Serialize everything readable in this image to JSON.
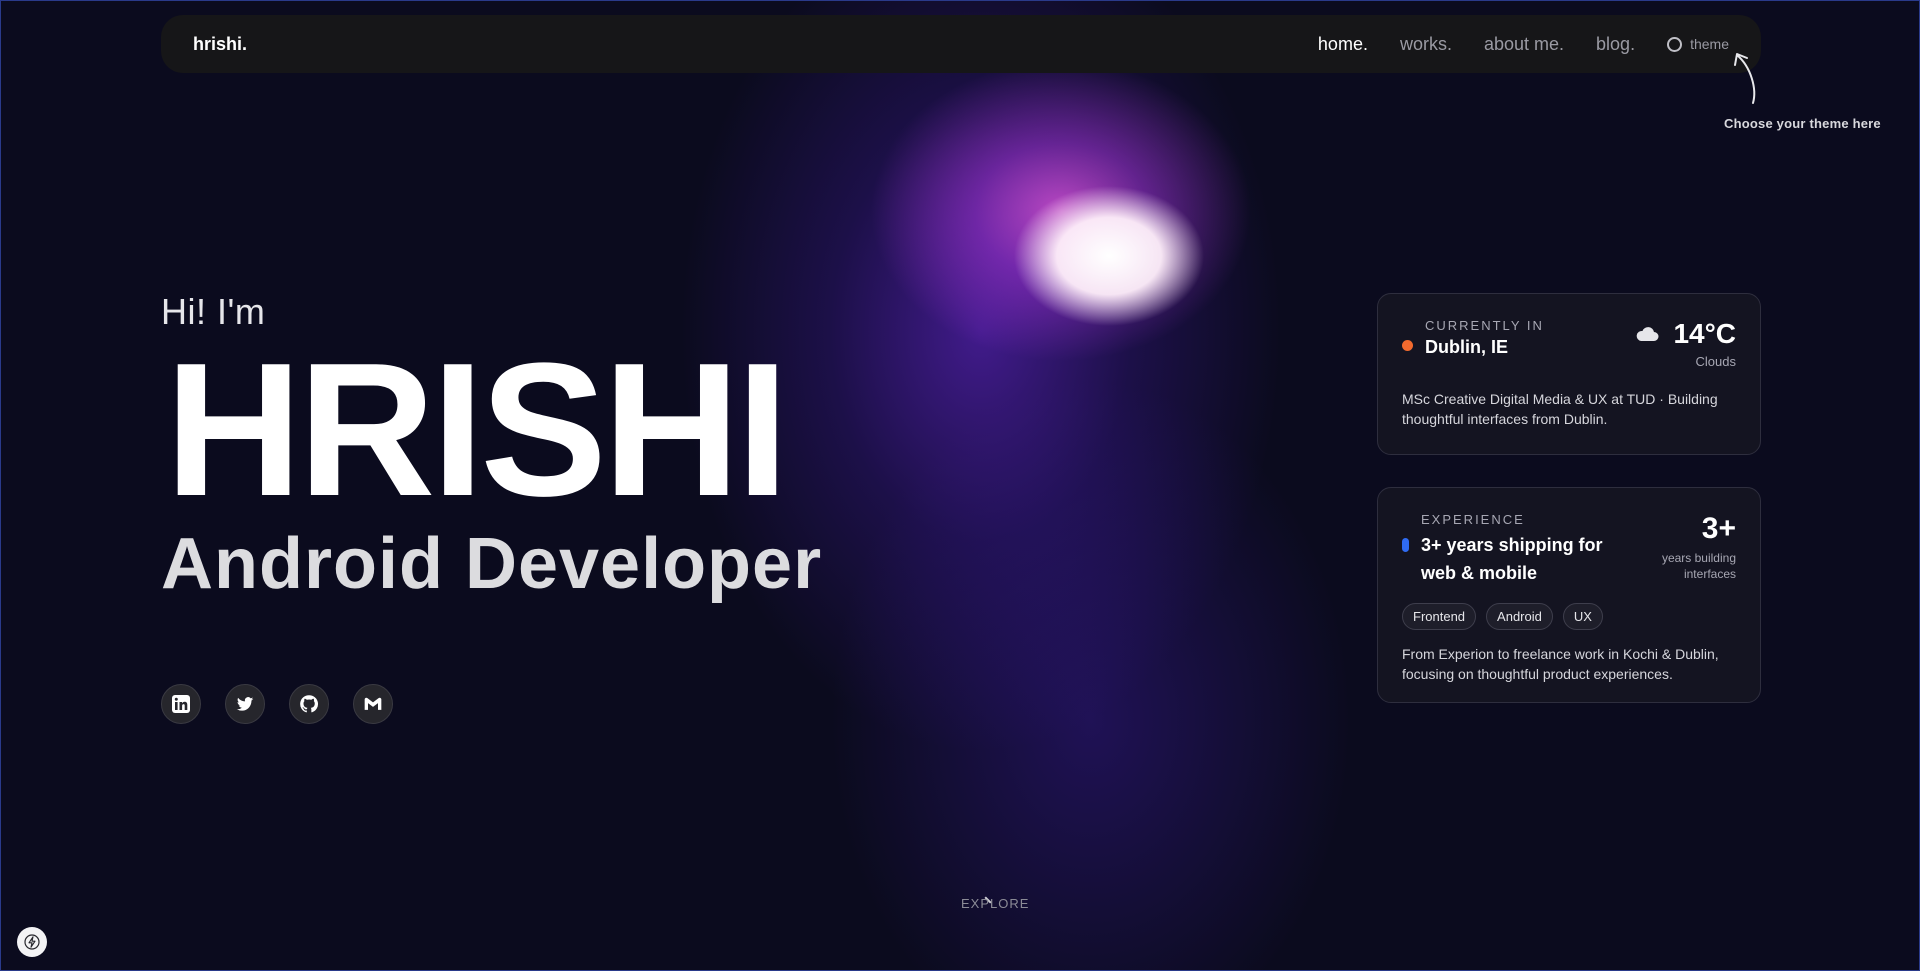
{
  "nav": {
    "brand": "hrishi.",
    "links": [
      {
        "label": "home."
      },
      {
        "label": "works."
      },
      {
        "label": "about me."
      },
      {
        "label": "blog."
      }
    ],
    "theme_label": "theme",
    "theme_hint": "Choose your theme here"
  },
  "hero": {
    "greeting": "Hi! I'm",
    "name": "HRISHI",
    "role": "Android Developer"
  },
  "socials": [
    {
      "icon": "linkedin-icon"
    },
    {
      "icon": "twitter-icon"
    },
    {
      "icon": "github-icon"
    },
    {
      "icon": "gmail-icon"
    }
  ],
  "location_card": {
    "eyebrow": "CURRENTLY IN",
    "city": "Dublin, IE",
    "temperature": "14°C",
    "condition": "Clouds",
    "description": "MSc Creative Digital Media & UX at TUD · Building thoughtful interfaces from Dublin."
  },
  "experience_card": {
    "eyebrow": "EXPERIENCE",
    "title": "3+ years shipping for web & mobile",
    "number": "3+",
    "number_caption": "years building interfaces",
    "tags": [
      "Frontend",
      "Android",
      "UX"
    ],
    "description": "From Experion to freelance work in Kochi & Dublin, focusing on thoughtful product experiences."
  },
  "explore_label": "EXPLORE",
  "colors": {
    "background": "#0b0b1e",
    "accent_orange": "#f26a2e",
    "accent_blue": "#2f6bf2",
    "glow_purple": "#7a2ee6"
  }
}
